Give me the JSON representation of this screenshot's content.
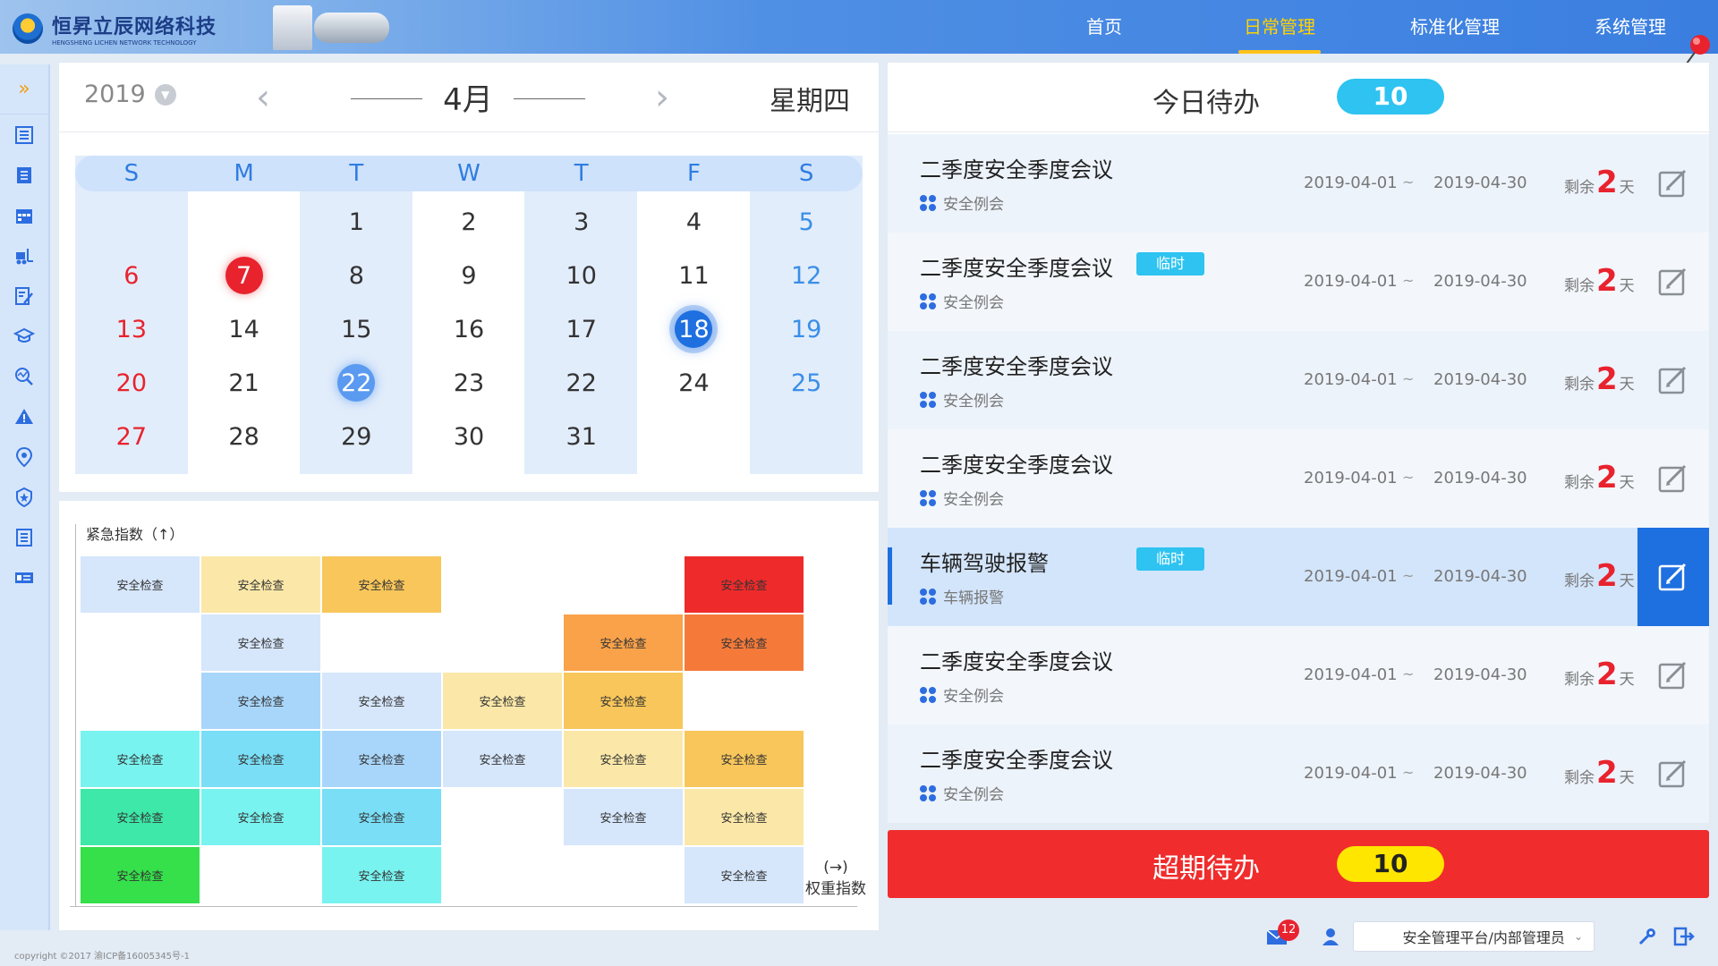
{
  "app": {
    "company_name": "恒昇立辰网络科技",
    "company_name_en": "HENGSHENG LICHEN NETWORK TECHNOLOGY"
  },
  "nav": {
    "items": [
      {
        "label": "首页",
        "active": false
      },
      {
        "label": "日常管理",
        "active": true
      },
      {
        "label": "标准化管理",
        "active": false
      },
      {
        "label": "系统管理",
        "active": false
      }
    ]
  },
  "sidebar": {
    "toggle": "»",
    "icons": [
      "list-icon",
      "notebook-icon",
      "calendar-icon",
      "forklift-icon",
      "edit-doc-icon",
      "graduation-cap-icon",
      "chart-search-icon",
      "warning-icon",
      "location-pin-icon",
      "shield-star-icon",
      "document-icon",
      "vehicle-card-icon"
    ]
  },
  "calendar": {
    "year": "2019",
    "month": "4月",
    "weekday": "星期四",
    "prev": "‹",
    "next": "›",
    "dow": [
      "S",
      "M",
      "T",
      "W",
      "T",
      "F",
      "S"
    ],
    "weeks": [
      [
        "",
        "",
        "1",
        "2",
        "3",
        "4",
        "5"
      ],
      [
        "6",
        "7",
        "8",
        "9",
        "10",
        "11",
        "12"
      ],
      [
        "13",
        "14",
        "15",
        "16",
        "17",
        "18",
        "19"
      ],
      [
        "20",
        "21",
        "22",
        "23",
        "22",
        "24",
        "25"
      ],
      [
        "27",
        "28",
        "29",
        "30",
        "31",
        "",
        ""
      ]
    ],
    "highlight_red": "7",
    "highlight_today": "18",
    "highlight_light": "22"
  },
  "matrix": {
    "y_label": "紧急指数（↑）",
    "x_arrow": "(→)",
    "x_label": "权重指数",
    "cell_label": "安全检查",
    "cells": [
      {
        "row": 0,
        "col": 0,
        "color": "#d6e6fb"
      },
      {
        "row": 0,
        "col": 1,
        "color": "#fbe8a8"
      },
      {
        "row": 0,
        "col": 2,
        "color": "#f8c65a"
      },
      {
        "row": 0,
        "col": 5,
        "color": "#ef2a2a"
      },
      {
        "row": 1,
        "col": 1,
        "color": "#d6e6fb"
      },
      {
        "row": 1,
        "col": 4,
        "color": "#f9a24a"
      },
      {
        "row": 1,
        "col": 5,
        "color": "#f57a3a"
      },
      {
        "row": 2,
        "col": 1,
        "color": "#a8d6fb"
      },
      {
        "row": 2,
        "col": 2,
        "color": "#d6e6fb"
      },
      {
        "row": 2,
        "col": 3,
        "color": "#fbe8a8"
      },
      {
        "row": 2,
        "col": 4,
        "color": "#f8c65a"
      },
      {
        "row": 3,
        "col": 0,
        "color": "#79f3f0"
      },
      {
        "row": 3,
        "col": 1,
        "color": "#79def6"
      },
      {
        "row": 3,
        "col": 2,
        "color": "#a8d6fb"
      },
      {
        "row": 3,
        "col": 3,
        "color": "#d6e6fb"
      },
      {
        "row": 3,
        "col": 4,
        "color": "#fbe8a8"
      },
      {
        "row": 3,
        "col": 5,
        "color": "#f8c65a"
      },
      {
        "row": 4,
        "col": 0,
        "color": "#3de8a8"
      },
      {
        "row": 4,
        "col": 1,
        "color": "#79f3f0"
      },
      {
        "row": 4,
        "col": 2,
        "color": "#79def6"
      },
      {
        "row": 4,
        "col": 4,
        "color": "#d6e6fb"
      },
      {
        "row": 4,
        "col": 5,
        "color": "#fbe8a8"
      },
      {
        "row": 5,
        "col": 0,
        "color": "#35e04a"
      },
      {
        "row": 5,
        "col": 2,
        "color": "#79f3f0"
      },
      {
        "row": 5,
        "col": 5,
        "color": "#d6e6fb"
      }
    ]
  },
  "todo": {
    "title": "今日待办",
    "count": "10",
    "items": [
      {
        "title": "二季度安全季度会议",
        "tag": "",
        "category": "安全例会",
        "start": "2019-04-01",
        "tilde": "~",
        "end": "2019-04-30",
        "remain_prefix": "剩余",
        "remain_days": "2",
        "remain_suffix": "天",
        "active": false
      },
      {
        "title": "二季度安全季度会议",
        "tag": "临时",
        "category": "安全例会",
        "start": "2019-04-01",
        "tilde": "~",
        "end": "2019-04-30",
        "remain_prefix": "剩余",
        "remain_days": "2",
        "remain_suffix": "天",
        "active": false
      },
      {
        "title": "二季度安全季度会议",
        "tag": "",
        "category": "安全例会",
        "start": "2019-04-01",
        "tilde": "~",
        "end": "2019-04-30",
        "remain_prefix": "剩余",
        "remain_days": "2",
        "remain_suffix": "天",
        "active": false
      },
      {
        "title": "二季度安全季度会议",
        "tag": "",
        "category": "安全例会",
        "start": "2019-04-01",
        "tilde": "~",
        "end": "2019-04-30",
        "remain_prefix": "剩余",
        "remain_days": "2",
        "remain_suffix": "天",
        "active": false
      },
      {
        "title": "车辆驾驶报警",
        "tag": "临时",
        "category": "车辆报警",
        "start": "2019-04-01",
        "tilde": "~",
        "end": "2019-04-30",
        "remain_prefix": "剩余",
        "remain_days": "2",
        "remain_suffix": "天",
        "active": true
      },
      {
        "title": "二季度安全季度会议",
        "tag": "",
        "category": "安全例会",
        "start": "2019-04-01",
        "tilde": "~",
        "end": "2019-04-30",
        "remain_prefix": "剩余",
        "remain_days": "2",
        "remain_suffix": "天",
        "active": false
      },
      {
        "title": "二季度安全季度会议",
        "tag": "",
        "category": "安全例会",
        "start": "2019-04-01",
        "tilde": "~",
        "end": "2019-04-30",
        "remain_prefix": "剩余",
        "remain_days": "2",
        "remain_suffix": "天",
        "active": false
      }
    ]
  },
  "overdue": {
    "title": "超期待办",
    "count": "10"
  },
  "footer": {
    "copyright": "copyright ©2017 渝ICP备16005345号-1",
    "mail_badge": "12",
    "account": "安全管理平台/内部管理员",
    "caret": "⌄"
  }
}
